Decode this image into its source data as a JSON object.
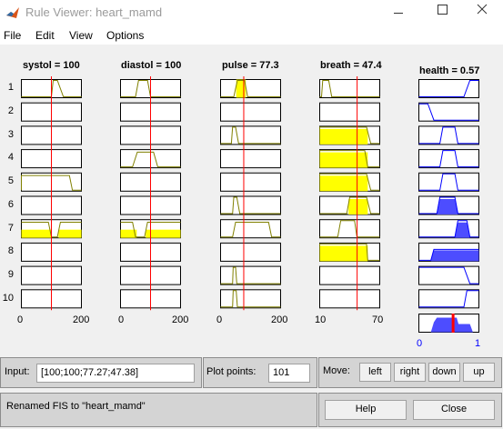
{
  "window": {
    "title": "Rule Viewer: heart_mamd",
    "minimize_icon": "minimize-icon",
    "maximize_icon": "maximize-icon",
    "close_icon": "close-icon",
    "app_icon": "matlab-icon"
  },
  "menu": [
    "File",
    "Edit",
    "View",
    "Options"
  ],
  "variables": {
    "inputs": [
      {
        "title": "systol = 100",
        "value": 100,
        "range": [
          0,
          200
        ],
        "min_label": "0",
        "max_label": "200"
      },
      {
        "title": "diastol = 100",
        "value": 100,
        "range": [
          0,
          200
        ],
        "min_label": "0",
        "max_label": "200"
      },
      {
        "title": "pulse = 77.3",
        "value": 77.3,
        "range": [
          0,
          200
        ],
        "min_label": "0",
        "max_label": "200"
      },
      {
        "title": "breath = 47.4",
        "value": 47.4,
        "range": [
          10,
          70
        ],
        "min_label": "10",
        "max_label": "70"
      }
    ],
    "output": {
      "title": "health = 0.57",
      "value": 0.57,
      "range": [
        0,
        1
      ],
      "min_label": "0",
      "max_label": "1"
    }
  },
  "rules": [
    "1",
    "2",
    "3",
    "4",
    "5",
    "6",
    "7",
    "8",
    "9",
    "10"
  ],
  "colors": {
    "fired": "#ffff00",
    "membership_line": "#808000",
    "value_line": "#ff0000",
    "output_fill": "#4d4dff",
    "output_line": "#0000ff",
    "crisp_line": "#ff0000"
  },
  "input_panel": {
    "label": "Input:",
    "value": "[100;100;77.27;47.38]"
  },
  "plot_points": {
    "label": "Plot points:",
    "value": "101"
  },
  "move": {
    "label": "Move:",
    "buttons": [
      "left",
      "right",
      "down",
      "up"
    ]
  },
  "status": "Renamed FIS to \"heart_mamd\"",
  "help_label": "Help",
  "close_label": "Close"
}
